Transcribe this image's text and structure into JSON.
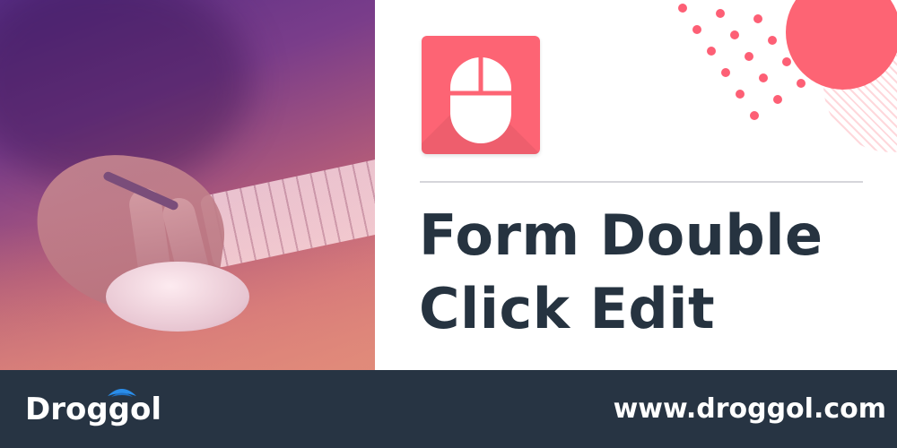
{
  "banner": {
    "title_line1": "Form Double",
    "title_line2": "Click Edit",
    "app_icon": "computer-mouse-icon"
  },
  "footer": {
    "brand": "Droggol",
    "url": "www.droggol.com"
  },
  "colors": {
    "accent": "#fd6474",
    "dark": "#263340",
    "footer_bg": "#273443",
    "photo_overlay_top": "#5a2f86",
    "photo_overlay_bottom": "#e08a7c"
  }
}
